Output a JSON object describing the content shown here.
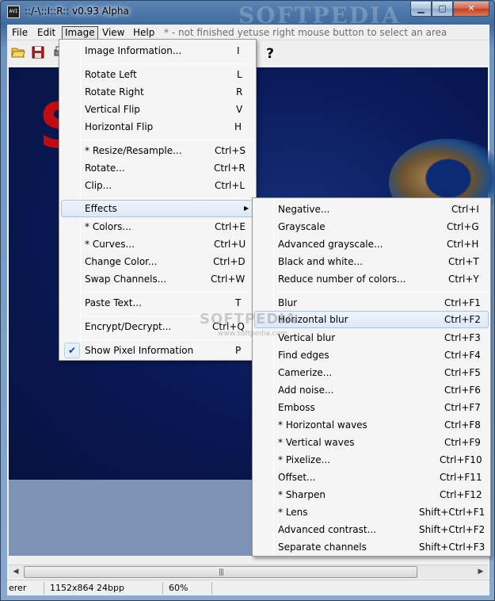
{
  "window": {
    "title": "::/-\\::I::R:: v0.93 Alpha",
    "icon_label": "AVI",
    "watermark": "SOFTPEDIA",
    "buttons": {
      "minimize": "▁",
      "maximize": "▢",
      "close": "✕"
    }
  },
  "menubar": {
    "items": [
      "File",
      "Edit",
      "Image",
      "View",
      "Help"
    ],
    "hint_not_finished": "* - not finished yet",
    "hint_select": "use right mouse button to select an area"
  },
  "toolbar": {
    "icons": [
      "open-icon",
      "save-icon",
      "print-icon",
      "help-icon"
    ],
    "help_glyph": "?"
  },
  "canvas": {
    "red_text": "S"
  },
  "image_menu": {
    "items": [
      {
        "label": "Image Information...",
        "shortcut": "I"
      },
      {
        "label": "Rotate Left",
        "shortcut": "L"
      },
      {
        "label": "Rotate Right",
        "shortcut": "R"
      },
      {
        "label": "Vertical Flip",
        "shortcut": "V"
      },
      {
        "label": "Horizontal Flip",
        "shortcut": "H"
      },
      {
        "label": "* Resize/Resample...",
        "shortcut": "Ctrl+S"
      },
      {
        "label": "Rotate...",
        "shortcut": "Ctrl+R"
      },
      {
        "label": "Clip...",
        "shortcut": "Ctrl+L"
      },
      {
        "label": "Effects",
        "shortcut": ""
      },
      {
        "label": "* Colors...",
        "shortcut": "Ctrl+E"
      },
      {
        "label": "* Curves...",
        "shortcut": "Ctrl+U"
      },
      {
        "label": "Change Color...",
        "shortcut": "Ctrl+D"
      },
      {
        "label": "Swap Channels...",
        "shortcut": "Ctrl+W"
      },
      {
        "label": "Paste Text...",
        "shortcut": "T"
      },
      {
        "label": "Encrypt/Decrypt...",
        "shortcut": "Ctrl+Q"
      },
      {
        "label": "Show Pixel Information",
        "shortcut": "P"
      }
    ],
    "checked_glyph": "✔"
  },
  "effects_menu": {
    "items": [
      {
        "label": "Negative...",
        "shortcut": "Ctrl+I"
      },
      {
        "label": "Grayscale",
        "shortcut": "Ctrl+G"
      },
      {
        "label": "Advanced grayscale...",
        "shortcut": "Ctrl+H"
      },
      {
        "label": "Black and white...",
        "shortcut": "Ctrl+T"
      },
      {
        "label": "Reduce number of colors...",
        "shortcut": "Ctrl+Y"
      },
      {
        "label": "Blur",
        "shortcut": "Ctrl+F1"
      },
      {
        "label": "Horizontal blur",
        "shortcut": "Ctrl+F2"
      },
      {
        "label": "Vertical blur",
        "shortcut": "Ctrl+F3"
      },
      {
        "label": "Find edges",
        "shortcut": "Ctrl+F4"
      },
      {
        "label": "Camerize...",
        "shortcut": "Ctrl+F5"
      },
      {
        "label": "Add noise...",
        "shortcut": "Ctrl+F6"
      },
      {
        "label": "Emboss",
        "shortcut": "Ctrl+F7"
      },
      {
        "label": "* Horizontal waves",
        "shortcut": "Ctrl+F8"
      },
      {
        "label": "* Vertical waves",
        "shortcut": "Ctrl+F9"
      },
      {
        "label": "* Pixelize...",
        "shortcut": "Ctrl+F10"
      },
      {
        "label": "Offset...",
        "shortcut": "Ctrl+F11"
      },
      {
        "label": "* Sharpen",
        "shortcut": "Ctrl+F12"
      },
      {
        "label": "* Lens",
        "shortcut": "Shift+Ctrl+F1"
      },
      {
        "label": "Advanced contrast...",
        "shortcut": "Shift+Ctrl+F2"
      },
      {
        "label": "Separate channels",
        "shortcut": "Shift+Ctrl+F3"
      }
    ]
  },
  "watermark": {
    "main": "SOFTPEDIA",
    "sub": "www.softpedia.com"
  },
  "statusbar": {
    "left": "erer",
    "dimensions": "1152x864 24bpp",
    "zoom": "60%"
  },
  "scrollbar": {
    "left_arrow": "◀",
    "right_arrow": "▶",
    "grip": "|||"
  },
  "colors": {
    "canvas": "#0a1a5a",
    "menu_highlight": "#dde8f6",
    "red_text": "#d20b0b"
  }
}
